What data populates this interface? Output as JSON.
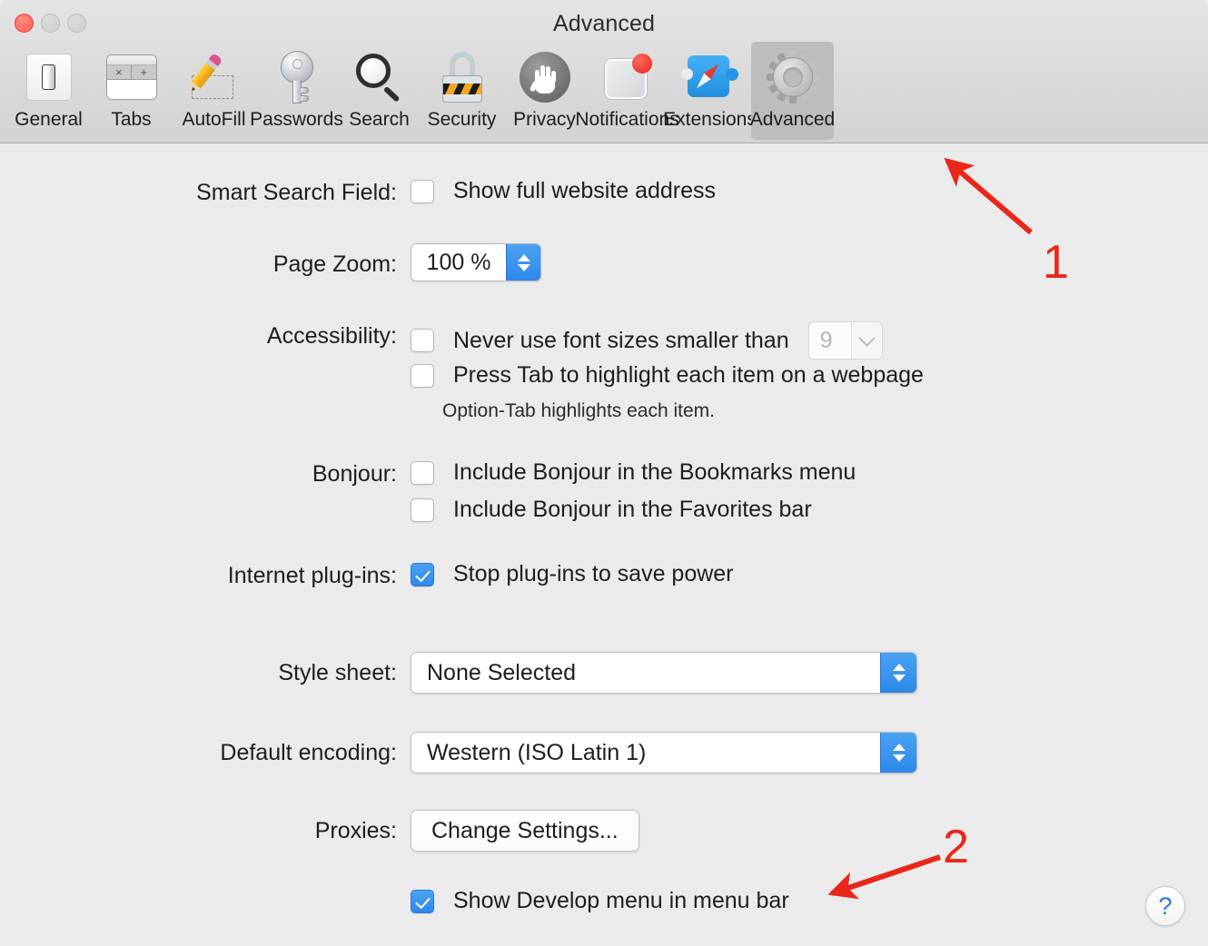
{
  "window": {
    "title": "Advanced",
    "traffic_lights": [
      "close",
      "minimize",
      "zoom"
    ]
  },
  "toolbar": {
    "tabs": [
      {
        "label": "General",
        "icon": "general-icon",
        "selected": false
      },
      {
        "label": "Tabs",
        "icon": "tabs-icon",
        "selected": false
      },
      {
        "label": "AutoFill",
        "icon": "autofill-pencil-icon",
        "selected": false
      },
      {
        "label": "Passwords",
        "icon": "key-icon",
        "selected": false
      },
      {
        "label": "Search",
        "icon": "magnifier-icon",
        "selected": false
      },
      {
        "label": "Security",
        "icon": "padlock-icon",
        "selected": false
      },
      {
        "label": "Privacy",
        "icon": "hand-icon",
        "selected": false
      },
      {
        "label": "Notifications",
        "icon": "notification-badge-icon",
        "selected": false
      },
      {
        "label": "Extensions",
        "icon": "puzzle-compass-icon",
        "selected": false
      },
      {
        "label": "Advanced",
        "icon": "gear-icon",
        "selected": true
      }
    ]
  },
  "settings": {
    "smart_search_field": {
      "label": "Smart Search Field:",
      "checkbox_label": "Show full website address",
      "checked": false
    },
    "page_zoom": {
      "label": "Page Zoom:",
      "value": "100 %"
    },
    "accessibility": {
      "label": "Accessibility:",
      "font_size_label": "Never use font sizes smaller than",
      "font_size_checked": false,
      "font_size_value": "9",
      "font_size_disabled": true,
      "tab_highlight_label": "Press Tab to highlight each item on a webpage",
      "tab_highlight_checked": false,
      "hint": "Option-Tab highlights each item."
    },
    "bonjour": {
      "label": "Bonjour:",
      "bookmarks_label": "Include Bonjour in the Bookmarks menu",
      "bookmarks_checked": false,
      "favorites_label": "Include Bonjour in the Favorites bar",
      "favorites_checked": false
    },
    "internet_plugins": {
      "label": "Internet plug-ins:",
      "checkbox_label": "Stop plug-ins to save power",
      "checked": true
    },
    "style_sheet": {
      "label": "Style sheet:",
      "value": "None Selected"
    },
    "default_encoding": {
      "label": "Default encoding:",
      "value": "Western (ISO Latin 1)"
    },
    "proxies": {
      "label": "Proxies:",
      "button_label": "Change Settings..."
    },
    "develop_menu": {
      "checkbox_label": "Show Develop menu in menu bar",
      "checked": true
    }
  },
  "help": {
    "glyph": "?"
  },
  "annotations": {
    "color": "#e8271a",
    "items": [
      {
        "number": "1",
        "points_to": "advanced-tab"
      },
      {
        "number": "2",
        "points_to": "develop-menu-checkbox"
      }
    ]
  }
}
